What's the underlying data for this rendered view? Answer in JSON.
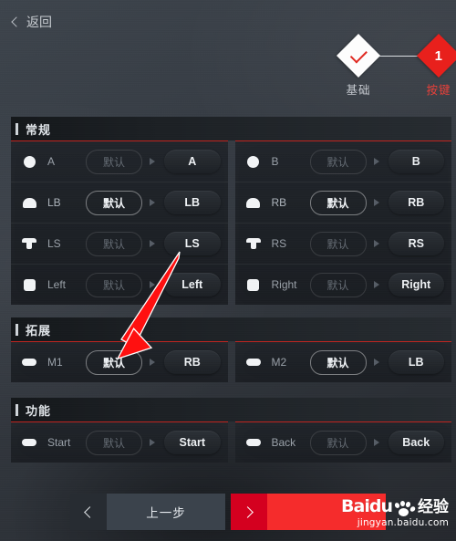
{
  "header": {
    "back_label": "返回",
    "back_icon": "chevron-left-icon"
  },
  "steps": {
    "connector_color": "#d8dce0",
    "items": [
      {
        "label": "基础",
        "state": "done",
        "marker": "check-icon",
        "number": ""
      },
      {
        "label": "按键",
        "state": "current",
        "marker": "number",
        "number": "1"
      }
    ]
  },
  "colors": {
    "accent_red": "#e8201c",
    "panel_border_red": "#c2241f",
    "next_button_red": "#f52c2c",
    "prev_button_gray": "#3b434c"
  },
  "common": {
    "default_label": "默认",
    "arrow_icon": "triangle-right-icon"
  },
  "sections": [
    {
      "title": "常规",
      "columns": [
        {
          "rows": [
            {
              "icon": "circle-button-icon",
              "name": "A",
              "default_label": "默认",
              "default_active": false,
              "mapped_value": "A"
            },
            {
              "icon": "bumper-icon",
              "name": "LB",
              "default_label": "默认",
              "default_active": true,
              "mapped_value": "LB"
            },
            {
              "icon": "stick-icon",
              "name": "LS",
              "default_label": "默认",
              "default_active": false,
              "mapped_value": "LS"
            },
            {
              "icon": "dpad-icon",
              "name": "Left",
              "default_label": "默认",
              "default_active": false,
              "mapped_value": "Left"
            }
          ]
        },
        {
          "rows": [
            {
              "icon": "circle-button-icon",
              "name": "B",
              "default_label": "默认",
              "default_active": false,
              "mapped_value": "B"
            },
            {
              "icon": "bumper-icon",
              "name": "RB",
              "default_label": "默认",
              "default_active": true,
              "mapped_value": "RB"
            },
            {
              "icon": "stick-icon",
              "name": "RS",
              "default_label": "默认",
              "default_active": false,
              "mapped_value": "RS"
            },
            {
              "icon": "dpad-icon",
              "name": "Right",
              "default_label": "默认",
              "default_active": false,
              "mapped_value": "Right"
            }
          ]
        }
      ]
    },
    {
      "title": "拓展",
      "columns": [
        {
          "rows": [
            {
              "icon": "pill-button-icon",
              "name": "M1",
              "default_label": "默认",
              "default_active": true,
              "mapped_value": "RB"
            }
          ]
        },
        {
          "rows": [
            {
              "icon": "pill-button-icon",
              "name": "M2",
              "default_label": "默认",
              "default_active": true,
              "mapped_value": "LB"
            }
          ]
        }
      ]
    },
    {
      "title": "功能",
      "columns": [
        {
          "rows": [
            {
              "icon": "pill-button-icon",
              "name": "Start",
              "default_label": "默认",
              "default_active": false,
              "mapped_value": "Start"
            }
          ]
        },
        {
          "rows": [
            {
              "icon": "pill-button-icon",
              "name": "Back",
              "default_label": "默认",
              "default_active": false,
              "mapped_value": "Back"
            }
          ]
        }
      ]
    }
  ],
  "footer": {
    "prev_label": "上一步",
    "prev_icon": "chevron-left-icon",
    "next_label": "",
    "next_icon": "chevron-right-icon"
  },
  "watermark": {
    "brand": "Baidu",
    "suffix": "经验",
    "url": "jingyan.baidu.com"
  }
}
